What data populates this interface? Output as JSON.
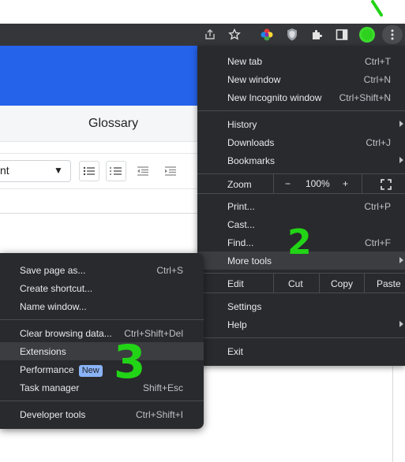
{
  "toolbar": {
    "icons": [
      "share-icon",
      "bookmark-star-icon",
      "color-extension-icon",
      "shield-extension-icon",
      "puzzle-extensions-icon",
      "side-panel-icon",
      "profile-avatar-icon",
      "kebab-menu-icon"
    ]
  },
  "page": {
    "tab_label": "Glossary",
    "font_value": "nt"
  },
  "chrome_menu": {
    "new_tab": {
      "label": "New tab",
      "shortcut": "Ctrl+T"
    },
    "new_window": {
      "label": "New window",
      "shortcut": "Ctrl+N"
    },
    "new_incognito": {
      "label": "New Incognito window",
      "shortcut": "Ctrl+Shift+N"
    },
    "history": {
      "label": "History"
    },
    "downloads": {
      "label": "Downloads",
      "shortcut": "Ctrl+J"
    },
    "bookmarks": {
      "label": "Bookmarks"
    },
    "zoom": {
      "label": "Zoom",
      "minus": "−",
      "value": "100%",
      "plus": "+"
    },
    "print": {
      "label": "Print...",
      "shortcut": "Ctrl+P"
    },
    "cast": {
      "label": "Cast..."
    },
    "find": {
      "label": "Find...",
      "shortcut": "Ctrl+F"
    },
    "more_tools": {
      "label": "More tools"
    },
    "edit": {
      "label": "Edit",
      "cut": "Cut",
      "copy": "Copy",
      "paste": "Paste"
    },
    "settings": {
      "label": "Settings"
    },
    "help": {
      "label": "Help"
    },
    "exit": {
      "label": "Exit"
    }
  },
  "more_tools_menu": {
    "save_page": {
      "label": "Save page as...",
      "shortcut": "Ctrl+S"
    },
    "create_shortcut": {
      "label": "Create shortcut..."
    },
    "name_window": {
      "label": "Name window..."
    },
    "clear_browsing": {
      "label": "Clear browsing data...",
      "shortcut": "Ctrl+Shift+Del"
    },
    "extensions": {
      "label": "Extensions"
    },
    "performance": {
      "label": "Performance",
      "badge": "New"
    },
    "task_manager": {
      "label": "Task manager",
      "shortcut": "Shift+Esc"
    },
    "developer_tools": {
      "label": "Developer tools",
      "shortcut": "Ctrl+Shift+I"
    }
  },
  "annotations": {
    "step2": "2",
    "step3": "3"
  },
  "colors": {
    "menu_bg": "#292a2d",
    "menu_highlight": "#3c3d41",
    "page_header_blue": "#2563eb",
    "annotation_green": "#22d416",
    "badge_blue": "#8ab4f8"
  }
}
